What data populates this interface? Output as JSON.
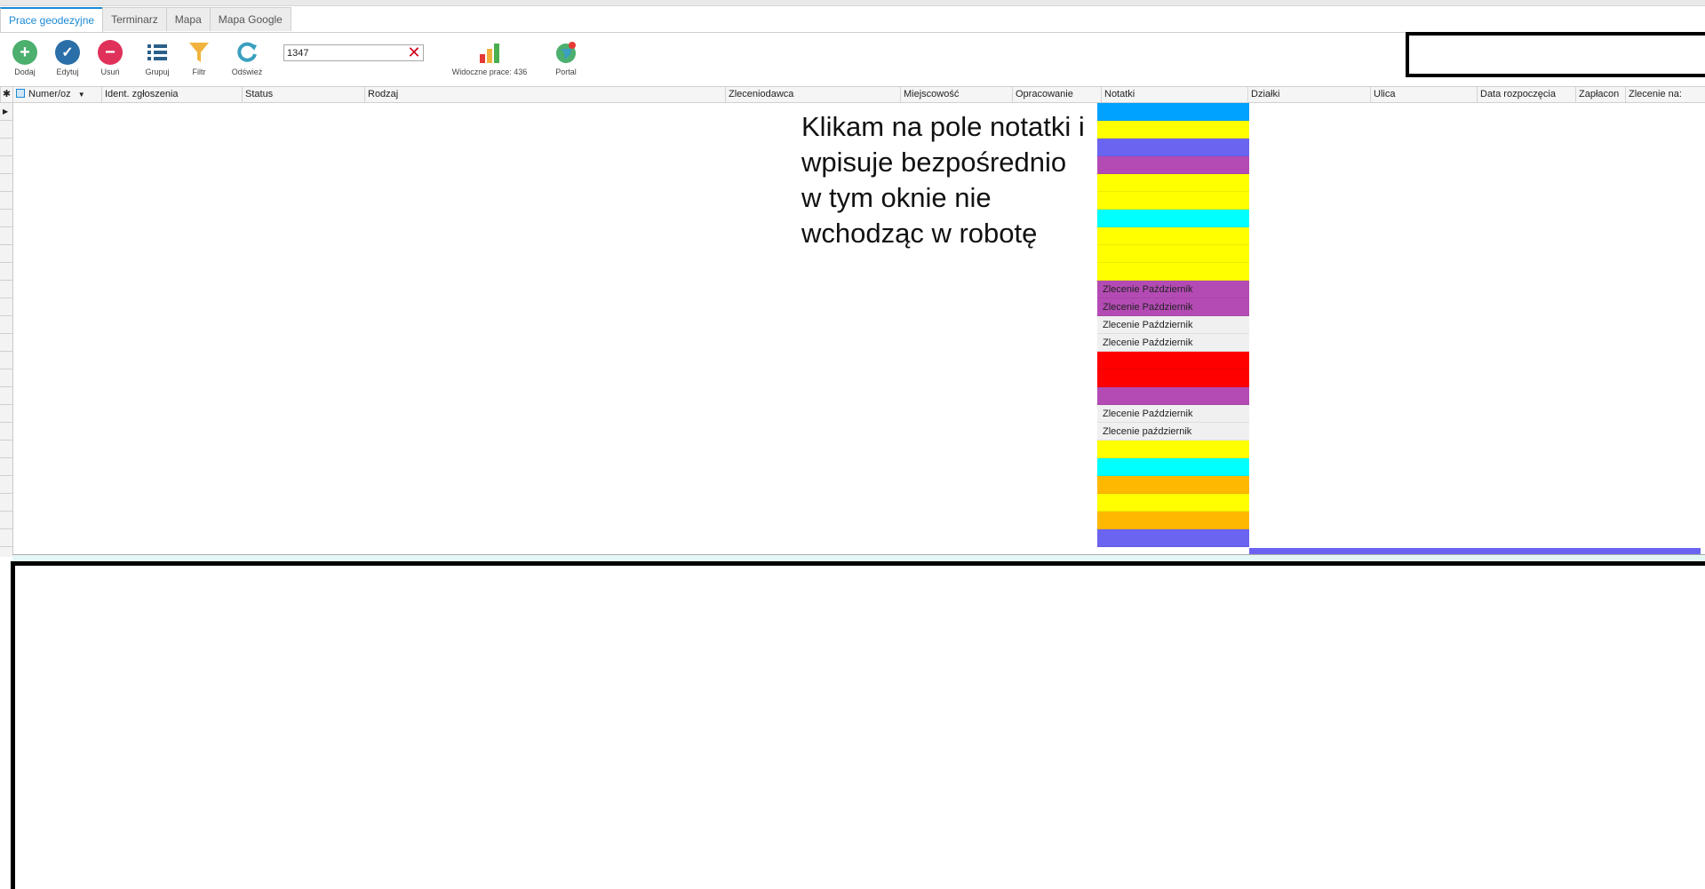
{
  "tabs": [
    {
      "label": "Prace geodezyjne",
      "active": true
    },
    {
      "label": "Terminarz",
      "active": false
    },
    {
      "label": "Mapa",
      "active": false
    },
    {
      "label": "Mapa Google",
      "active": false
    }
  ],
  "toolbar": {
    "add_label": "Dodaj",
    "edit_label": "Edytuj",
    "delete_label": "Usuń",
    "group_label": "Grupuj",
    "filter_label": "Filtr",
    "refresh_label": "Odśwież",
    "visible_label": "Widoczne prace: 436",
    "portal_label": "Portal"
  },
  "search": {
    "value": "1347"
  },
  "columns": [
    {
      "label": "Numer/oz"
    },
    {
      "label": "Ident. zgłoszenia"
    },
    {
      "label": "Status"
    },
    {
      "label": "Rodzaj"
    },
    {
      "label": "Zleceniodawca"
    },
    {
      "label": "Miejscowość"
    },
    {
      "label": "Opracowanie"
    },
    {
      "label": "Notatki"
    },
    {
      "label": "Działki"
    },
    {
      "label": "Ulica"
    },
    {
      "label": "Data rozpoczęcia"
    },
    {
      "label": "Zapłacon"
    },
    {
      "label": "Zlecenie na:"
    }
  ],
  "notes": [
    {
      "text": "",
      "color": "#00a2ff"
    },
    {
      "text": "",
      "color": "#ffff00"
    },
    {
      "text": "",
      "color": "#6b64f0"
    },
    {
      "text": "",
      "color": "#b44bb4"
    },
    {
      "text": "",
      "color": "#ffff00"
    },
    {
      "text": "",
      "color": "#ffff00"
    },
    {
      "text": "",
      "color": "#00ffff"
    },
    {
      "text": "",
      "color": "#ffff00"
    },
    {
      "text": "",
      "color": "#ffff00"
    },
    {
      "text": "",
      "color": "#ffff00"
    },
    {
      "text": "Zlecenie Październik",
      "color": "#b44bb4"
    },
    {
      "text": "Zlecenie Październik",
      "color": "#b44bb4"
    },
    {
      "text": "Zlecenie Październik",
      "color": "#f0f0f0"
    },
    {
      "text": "Zlecenie Październik",
      "color": "#f0f0f0"
    },
    {
      "text": "",
      "color": "#ff0000"
    },
    {
      "text": "",
      "color": "#ff0000"
    },
    {
      "text": "",
      "color": "#b44bb4"
    },
    {
      "text": "Zlecenie Październik",
      "color": "#f0f0f0"
    },
    {
      "text": "Zlecenie październik",
      "color": "#f0f0f0"
    },
    {
      "text": "",
      "color": "#ffff00"
    },
    {
      "text": "",
      "color": "#00ffff"
    },
    {
      "text": "",
      "color": "#ffb800"
    },
    {
      "text": "",
      "color": "#ffff00"
    },
    {
      "text": "",
      "color": "#ffb800"
    },
    {
      "text": "",
      "color": "#6b64f0"
    }
  ],
  "overlay_text": "Klikam na pole notatki i wpisuje bezpośrednio w tym oknie nie wchodząc w robotę",
  "colors": {
    "accent": "#1a8ad4",
    "add": "#4caf6e",
    "edit": "#2a6fa8",
    "delete": "#e0315a",
    "filter": "#f2b33d",
    "refresh": "#3a9fc0"
  }
}
